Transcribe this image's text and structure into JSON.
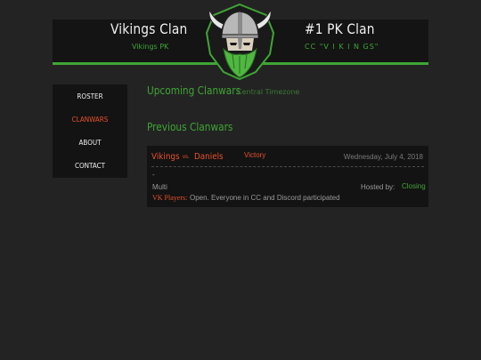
{
  "header": {
    "left_title": "Vikings Clan",
    "left_subtitle": "Vikings PK",
    "right_title": "#1 PK Clan",
    "right_subtitle": "CC \"V I K I N GS\"",
    "logo_icon": "viking-warrior-logo"
  },
  "nav": {
    "items": [
      {
        "label": "ROSTER",
        "active": false
      },
      {
        "label": "CLANWARS",
        "active": true
      },
      {
        "label": "ABOUT",
        "active": false
      },
      {
        "label": "CONTACT",
        "active": false
      }
    ]
  },
  "upcoming": {
    "title": "Upcoming Clanwars",
    "note": "Central Timezone"
  },
  "previous": {
    "title": "Previous Clanwars",
    "wars": [
      {
        "team1": "Vikings",
        "vs": "vs.",
        "team2": "Daniels",
        "result": "Victory",
        "date": "Wednesday, July 4, 2018",
        "dash": "-",
        "format": "Multi",
        "hosted_label": "Hosted by:",
        "host": "Closing",
        "players_label": "VK Players:",
        "players": "Open. Everyone in CC and Discord participated"
      }
    ]
  },
  "colors": {
    "background": "#232323",
    "panel": "#131313",
    "accent_green": "#3fa535",
    "accent_orange": "#e8512c"
  }
}
